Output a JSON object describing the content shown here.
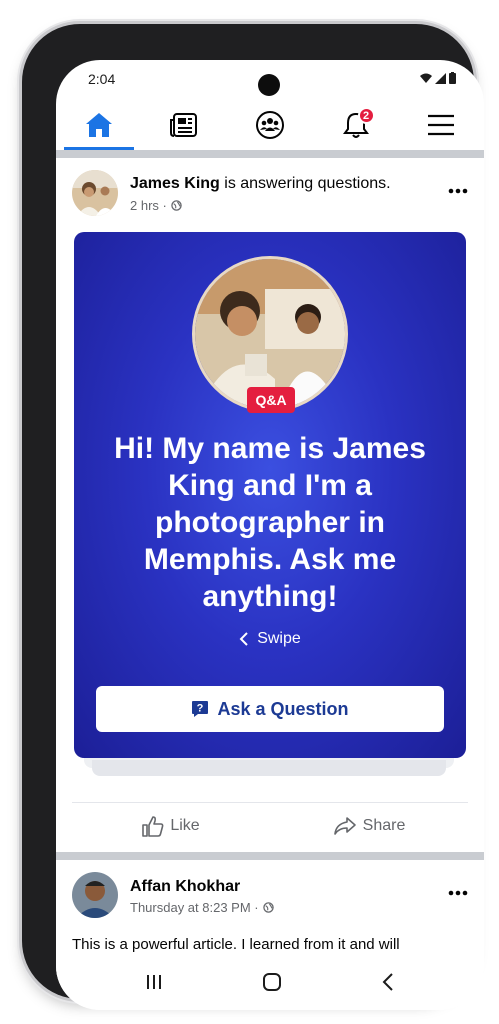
{
  "status_bar": {
    "time": "2:04",
    "icons": [
      "wifi-icon",
      "signal-icon",
      "battery-icon"
    ]
  },
  "nav": {
    "items": [
      {
        "name": "home",
        "icon": "home-icon",
        "active": true
      },
      {
        "name": "news",
        "icon": "news-feed-icon",
        "active": false
      },
      {
        "name": "groups",
        "icon": "groups-icon",
        "active": false
      },
      {
        "name": "notifications",
        "icon": "bell-icon",
        "active": false,
        "badge": "2"
      },
      {
        "name": "menu",
        "icon": "hamburger-menu-icon",
        "active": false
      }
    ]
  },
  "post": {
    "author": "James King",
    "action_text": " is answering questions.",
    "time": "2 hrs ·",
    "privacy_icon": "globe-icon",
    "qa_card": {
      "badge": "Q&A",
      "headline": "Hi! My name is James King and I'm a photographer in Memphis. Ask me anything!",
      "swipe_label": "Swipe",
      "ask_button_label": "Ask a Question"
    },
    "actions": {
      "like_label": "Like",
      "share_label": "Share"
    }
  },
  "post2": {
    "author": "Affan Khokhar",
    "time": "Thursday at 8:23 PM ·",
    "privacy_icon": "globe-icon",
    "text": "This is a powerful article. I learned from it and will"
  },
  "colors": {
    "accent": "#1b74e4",
    "badge_red": "#e41e3f",
    "card_blue": "#2a32c2",
    "secondary_text": "#65676b"
  }
}
